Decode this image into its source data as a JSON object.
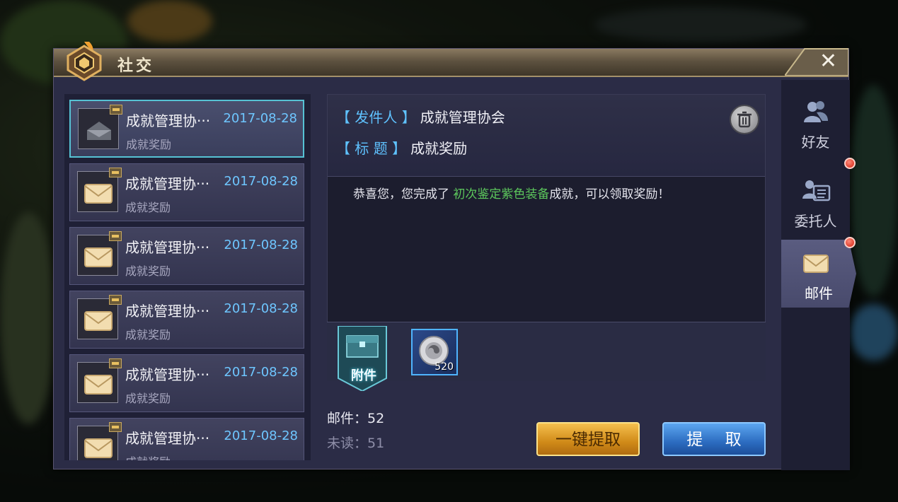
{
  "window": {
    "title": "社交"
  },
  "mails": [
    {
      "sender": "成就管理协···",
      "date": "2017-08-28",
      "subject": "成就奖励",
      "opened": true
    },
    {
      "sender": "成就管理协···",
      "date": "2017-08-28",
      "subject": "成就奖励",
      "opened": false
    },
    {
      "sender": "成就管理协···",
      "date": "2017-08-28",
      "subject": "成就奖励",
      "opened": false
    },
    {
      "sender": "成就管理协···",
      "date": "2017-08-28",
      "subject": "成就奖励",
      "opened": false
    },
    {
      "sender": "成就管理协···",
      "date": "2017-08-28",
      "subject": "成就奖励",
      "opened": false
    },
    {
      "sender": "成就管理协···",
      "date": "2017-08-28",
      "subject": "成就奖励",
      "opened": false
    }
  ],
  "detail": {
    "sender_label": "【 发件人 】",
    "sender_value": "成就管理协会",
    "subject_label": "【 标  题 】",
    "subject_value": "成就奖励",
    "body_prefix": "恭喜您，您完成了 ",
    "body_highlight": "初次鉴定紫色装备",
    "body_suffix": "成就，可以领取奖励！",
    "attachment_label": "附件",
    "attachment_item_count": "520"
  },
  "stats": {
    "total_label": "邮件：",
    "total_value": "52",
    "unread_label": "未读：",
    "unread_value": "51"
  },
  "buttons": {
    "claim_all": "一键提取",
    "claim": "提 取"
  },
  "tabs": [
    {
      "label": "好友",
      "active": false,
      "notify": false
    },
    {
      "label": "委托人",
      "active": false,
      "notify": true
    },
    {
      "label": "邮件",
      "active": true,
      "notify": true
    }
  ],
  "colors": {
    "date": "#6ec6ff",
    "label_blue": "#5fc2ff",
    "highlight_green": "#5cc75c",
    "selected_border": "#56c2d4"
  },
  "icons": {
    "emblem": "social-emblem-icon",
    "close": "close-icon",
    "delete": "trash-icon",
    "mail_open": "open-envelope-icon",
    "mail_closed": "envelope-icon",
    "friends": "friends-icon",
    "client": "client-card-icon",
    "mail_tab": "mail-icon",
    "attachment": "attachment-chest-icon",
    "coin": "coin-item-icon"
  }
}
